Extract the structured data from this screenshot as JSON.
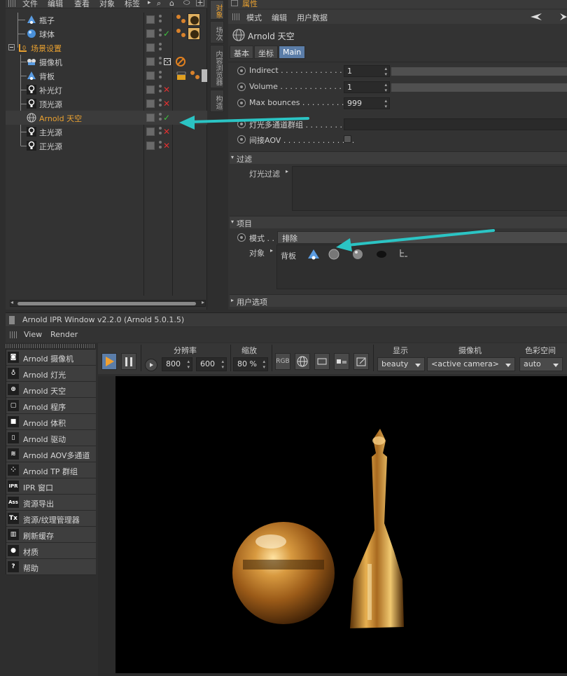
{
  "object_manager": {
    "menu": [
      "文件",
      "编辑",
      "查看",
      "对象",
      "标签"
    ],
    "objects": [
      {
        "name": "瓶子",
        "icon": "cone-object-icon",
        "status": "none",
        "tag": "material-tags"
      },
      {
        "name": "球体",
        "icon": "sphere-object-icon",
        "status": "check",
        "tag": "material-tags"
      },
      {
        "name": "场景设置",
        "icon": "null-group-icon",
        "status": "none",
        "tag": "none",
        "orange": true
      },
      {
        "name": "摄像机",
        "icon": "camera-icon",
        "status": "none",
        "tag": "protection-tag"
      },
      {
        "name": "背板",
        "icon": "cone-object-icon",
        "status": "none",
        "tag": "compositing-tags"
      },
      {
        "name": "补光灯",
        "icon": "light-bulb-icon",
        "status": "x",
        "tag": "none"
      },
      {
        "name": "顶光源",
        "icon": "light-bulb-icon",
        "status": "x",
        "tag": "none"
      },
      {
        "name": "Arnold 天空",
        "icon": "globe-icon",
        "status": "check",
        "tag": "none",
        "orange": true
      },
      {
        "name": "主光源",
        "icon": "light-bulb-icon",
        "status": "x",
        "tag": "none"
      },
      {
        "name": "正光源",
        "icon": "light-bulb-icon",
        "status": "x",
        "tag": "none"
      }
    ]
  },
  "side_tabs": [
    "对象",
    "场次",
    "内容浏览器",
    "构造"
  ],
  "attribute_manager": {
    "title": "属性",
    "menu": [
      "模式",
      "编辑",
      "用户数据"
    ],
    "object_title": "Arnold 天空",
    "tabs": [
      {
        "label": "基本",
        "active": false
      },
      {
        "label": "坐标",
        "active": false
      },
      {
        "label": "Main",
        "active": true
      }
    ],
    "params": [
      {
        "label": "Indirect . . . . . . . . . . . . . . . . .",
        "value": "1"
      },
      {
        "label": "Volume . . . . . . . . . . . . . . . . .",
        "value": "1"
      },
      {
        "label": "Max bounces . . . . . . . . . . . . .",
        "value": "999"
      },
      {
        "label": "灯光多通道群组 . . . . . . . .",
        "value": ""
      },
      {
        "label": "间接AOV . . . . . . . . . . . . . . .",
        "value": ""
      }
    ],
    "filter_section": "过滤",
    "light_filter_label": "灯光过滤",
    "project_section": "项目",
    "mode_label": "模式 . .",
    "mode_value": "排除",
    "objects_label": "对象",
    "objects_item": "背板",
    "user_options_section": "用户选项"
  },
  "ipr": {
    "title": "Arnold IPR Window v2.2.0 (Arnold 5.0.1.5)",
    "menu": [
      "View",
      "Render"
    ],
    "plugin_menu": [
      {
        "icon": "camera-icon",
        "glyph": "◙",
        "label": "Arnold 摄像机"
      },
      {
        "icon": "light-bulb-icon",
        "glyph": "♁",
        "label": "Arnold 灯光"
      },
      {
        "icon": "globe-icon",
        "glyph": "⊕",
        "label": "Arnold 天空"
      },
      {
        "icon": "procedural-icon",
        "glyph": "▢",
        "label": "Arnold 程序"
      },
      {
        "icon": "volume-icon",
        "glyph": "■",
        "label": "Arnold 体积"
      },
      {
        "icon": "driver-icon",
        "glyph": "▯",
        "label": "Arnold 驱动"
      },
      {
        "icon": "aov-layers-icon",
        "glyph": "≋",
        "label": "Arnold AOV多通道"
      },
      {
        "icon": "tp-group-icon",
        "glyph": "⁘",
        "label": "Arnold TP 群组"
      },
      {
        "icon": "ipr-icon",
        "glyph": "IPR",
        "label": "IPR 窗口"
      },
      {
        "icon": "ass-export-icon",
        "glyph": "Ass",
        "label": "资源导出"
      },
      {
        "icon": "tx-manager-icon",
        "glyph": "Tx",
        "label": "资源/纹理管理器"
      },
      {
        "icon": "trash-icon",
        "glyph": "▥",
        "label": "刷新缓存"
      },
      {
        "icon": "material-ball-icon",
        "glyph": "●",
        "label": "材质"
      },
      {
        "icon": "help-icon",
        "glyph": "?",
        "label": "帮助"
      }
    ],
    "toolbar": {
      "resolution_label": "分辨率",
      "width": "800",
      "height": "600",
      "zoom_label": "缩放",
      "zoom": "80 %",
      "rgb": "RGB",
      "display_label": "显示",
      "display_value": "beauty",
      "camera_label": "摄像机",
      "camera_value": "<active camera>",
      "colorspace_label": "色彩空间",
      "colorspace_value": "auto"
    }
  },
  "colors": {
    "accent_orange": "#e8a030",
    "tab_active": "#5b7da8",
    "annotation_arrow": "#2bc4c4",
    "gold": "#c8892a"
  }
}
